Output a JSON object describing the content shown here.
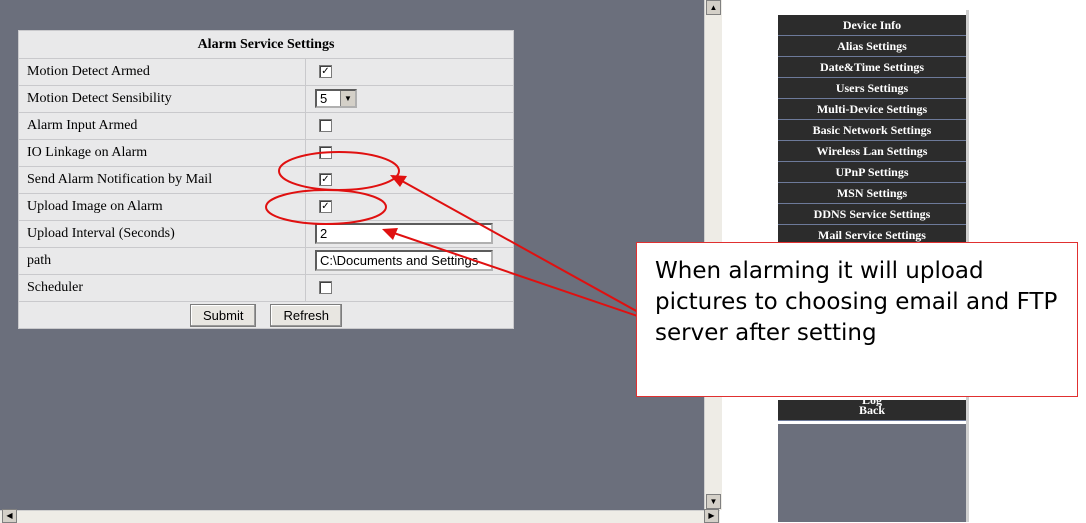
{
  "form": {
    "title": "Alarm Service Settings",
    "rows": [
      {
        "label": "Motion Detect Armed",
        "type": "checkbox",
        "checked": true
      },
      {
        "label": "Motion Detect Sensibility",
        "type": "select",
        "value": "5"
      },
      {
        "label": "Alarm Input Armed",
        "type": "checkbox",
        "checked": false
      },
      {
        "label": "IO Linkage on Alarm",
        "type": "checkbox",
        "checked": false
      },
      {
        "label": "Send Alarm Notification by Mail",
        "type": "checkbox",
        "checked": true
      },
      {
        "label": "Upload Image on Alarm",
        "type": "checkbox",
        "checked": true
      },
      {
        "label": "Upload Interval (Seconds)",
        "type": "text",
        "value": "2"
      },
      {
        "label": "path",
        "type": "text",
        "value": "C:\\Documents and Settings"
      },
      {
        "label": "Scheduler",
        "type": "checkbox",
        "checked": false
      }
    ],
    "submit_label": "Submit",
    "refresh_label": "Refresh",
    "check_glyph": "✓"
  },
  "sidebar": {
    "items": [
      "Device Info",
      "Alias Settings",
      "Date&Time Settings",
      "Users Settings",
      "Multi-Device Settings",
      "Basic Network Settings",
      "Wireless Lan Settings",
      "UPnP Settings",
      "MSN Settings",
      "DDNS Service Settings",
      "Mail Service Settings"
    ],
    "bottom_items": [
      "Log",
      "Back"
    ]
  },
  "callout": {
    "text": "When alarming it will upload pictures to choosing email and FTP server after setting"
  },
  "colors": {
    "annotation": "#e01010",
    "panel_bg": "#6b6f7c",
    "nav_bg": "#2c2c2c"
  },
  "icons": {
    "scroll_up": "▲",
    "scroll_down": "▼",
    "scroll_left": "◀",
    "scroll_right": "▶",
    "dropdown": "▼"
  }
}
